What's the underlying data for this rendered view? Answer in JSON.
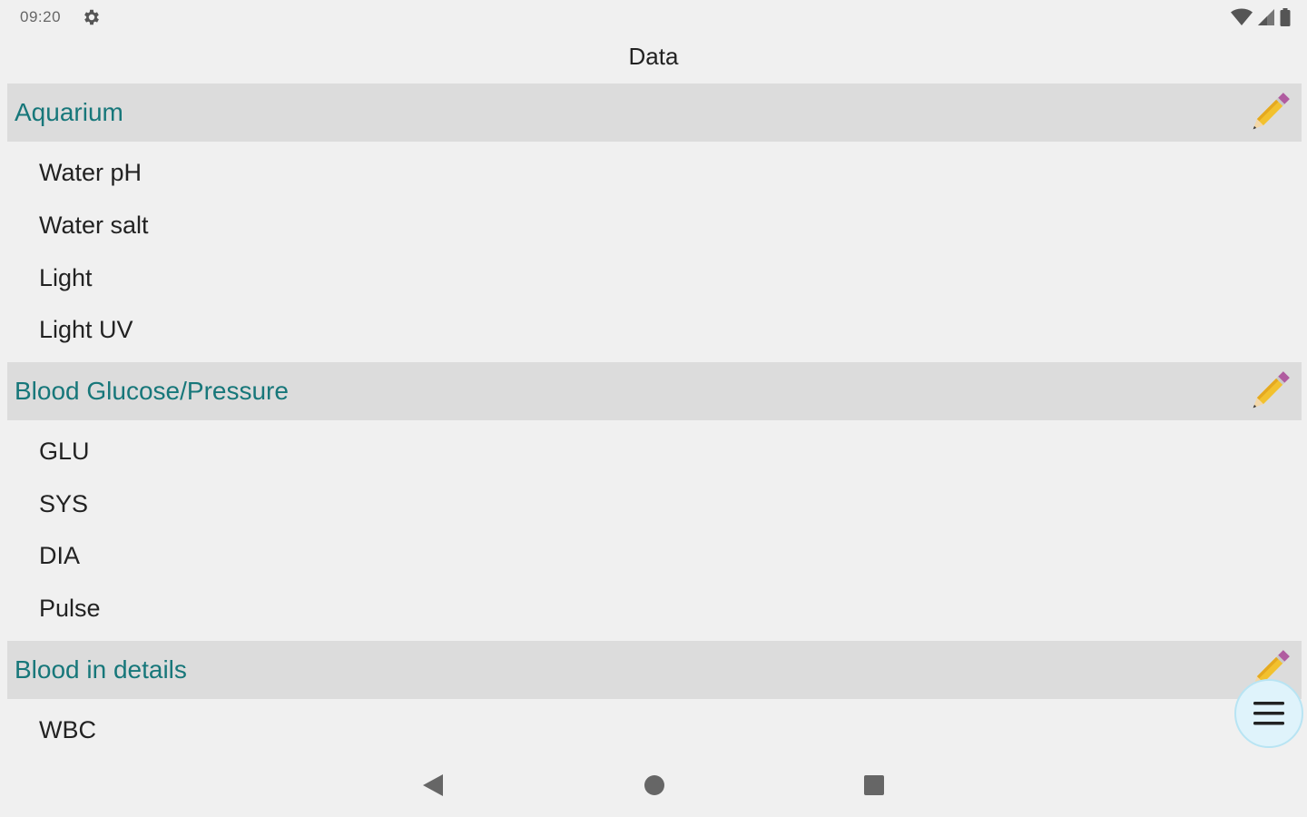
{
  "status_bar": {
    "time": "09:20",
    "icons": [
      "gear-icon",
      "wifi-icon",
      "signal-icon",
      "battery-icon"
    ]
  },
  "header": {
    "title": "Data"
  },
  "sections": [
    {
      "title": "Aquarium",
      "items": [
        "Water pH",
        "Water salt",
        "Light",
        "Light UV"
      ]
    },
    {
      "title": "Blood Glucose/Pressure",
      "items": [
        "GLU",
        "SYS",
        "DIA",
        "Pulse"
      ]
    },
    {
      "title": "Blood in details",
      "items": [
        "WBC"
      ]
    }
  ],
  "fab": {
    "icon": "menu-icon"
  },
  "nav_bar": {
    "icons": [
      "back-icon",
      "home-icon",
      "recents-icon"
    ]
  },
  "colors": {
    "section_title": "#17777a",
    "section_bg": "#dcdcdc",
    "background": "#f0f0f0",
    "fab_bg": "#dff3fb"
  }
}
